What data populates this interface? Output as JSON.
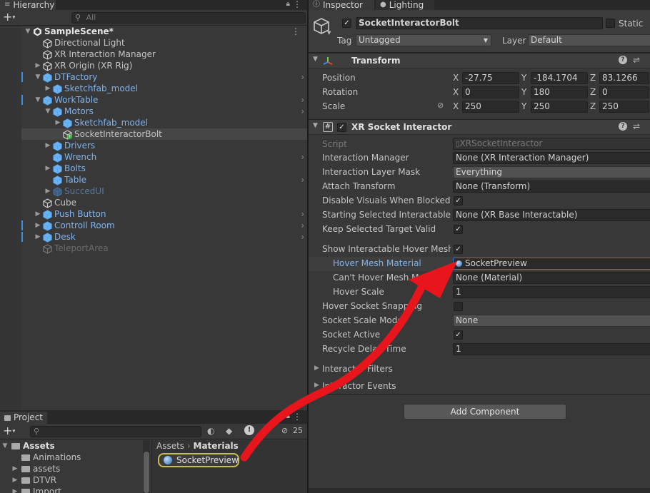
{
  "hierarchy": {
    "tab_label": "Hierarchy",
    "search_placeholder": "All",
    "rows": [
      {
        "label": "SampleScene*",
        "type": "scene",
        "indent": 0,
        "arrow": "▼",
        "color": "white"
      },
      {
        "label": "Directional Light",
        "type": "go",
        "indent": 1,
        "arrow": "",
        "color": "normal"
      },
      {
        "label": "XR Interaction Manager",
        "type": "go",
        "indent": 1,
        "arrow": "",
        "color": "normal"
      },
      {
        "label": "XR Origin (XR Rig)",
        "type": "go",
        "indent": 1,
        "arrow": "▶",
        "color": "normal"
      },
      {
        "label": "DTFactory",
        "type": "prefab",
        "indent": 1,
        "arrow": "▼",
        "color": "blue",
        "chevron": true,
        "bar": true
      },
      {
        "label": "Sketchfab_model",
        "type": "prefab",
        "indent": 2,
        "arrow": "▶",
        "color": "blue"
      },
      {
        "label": "WorkTable",
        "type": "prefab",
        "indent": 1,
        "arrow": "▼",
        "color": "blue",
        "chevron": true,
        "bar": true
      },
      {
        "label": "Motors",
        "type": "prefab",
        "indent": 2,
        "arrow": "▼",
        "color": "blue",
        "chevron": true
      },
      {
        "label": "Sketchfab_model",
        "type": "prefab",
        "indent": 3,
        "arrow": "▶",
        "color": "blue"
      },
      {
        "label": "SocketInteractorBolt",
        "type": "go-added",
        "indent": 3,
        "arrow": "",
        "color": "normal",
        "selected": true
      },
      {
        "label": "Drivers",
        "type": "prefab",
        "indent": 2,
        "arrow": "▶",
        "color": "blue"
      },
      {
        "label": "Wrench",
        "type": "prefab",
        "indent": 2,
        "arrow": "",
        "color": "blue",
        "chevron": true
      },
      {
        "label": "Bolts",
        "type": "prefab",
        "indent": 2,
        "arrow": "▶",
        "color": "blue"
      },
      {
        "label": "Table",
        "type": "prefab",
        "indent": 2,
        "arrow": "",
        "color": "blue",
        "chevron": true
      },
      {
        "label": "SuccedUI",
        "type": "prefab",
        "indent": 2,
        "arrow": "▶",
        "color": "dimblue"
      },
      {
        "label": "Cube",
        "type": "go",
        "indent": 1,
        "arrow": "",
        "color": "normal"
      },
      {
        "label": "Push Button",
        "type": "prefab",
        "indent": 1,
        "arrow": "▶",
        "color": "blue",
        "chevron": true
      },
      {
        "label": "Controll Room",
        "type": "prefab",
        "indent": 1,
        "arrow": "▶",
        "color": "blue",
        "chevron": true,
        "bar": true
      },
      {
        "label": "Desk",
        "type": "prefab",
        "indent": 1,
        "arrow": "▶",
        "color": "blue",
        "chevron": true,
        "bar": true
      },
      {
        "label": "TeleportArea",
        "type": "go",
        "indent": 1,
        "arrow": "",
        "color": "dim"
      }
    ]
  },
  "project": {
    "tab_label": "Project",
    "hidden_count": "25",
    "tree_root": "Assets",
    "tree_items": [
      "Animations",
      "assets",
      "DTVR",
      "Import"
    ],
    "breadcrumb": [
      "Assets",
      "Materials"
    ],
    "selected_asset": "SocketPreview"
  },
  "inspector": {
    "tabs": [
      "Inspector",
      "Lighting"
    ],
    "object_name": "SocketInteractorBolt",
    "static_label": "Static",
    "tag_label": "Tag",
    "tag_value": "Untagged",
    "layer_label": "Layer",
    "layer_value": "Default",
    "transform": {
      "title": "Transform",
      "rows": [
        {
          "label": "Position",
          "x": "-27.75",
          "y": "-184.1704",
          "z": "83.1266"
        },
        {
          "label": "Rotation",
          "x": "0",
          "y": "180",
          "z": "0"
        },
        {
          "label": "Scale",
          "x": "250",
          "y": "250",
          "z": "250"
        }
      ]
    },
    "socket": {
      "title": "XR Socket Interactor",
      "script_label": "Script",
      "script_value": "XRSocketInteractor",
      "props": [
        {
          "label": "Interaction Manager",
          "value": "None (XR Interaction Manager)",
          "kind": "object"
        },
        {
          "label": "Interaction Layer Mask",
          "value": "Everything",
          "kind": "dropdown"
        },
        {
          "label": "Attach Transform",
          "value": "None (Transform)",
          "kind": "object"
        },
        {
          "label": "Disable Visuals When Blocked In",
          "value": "",
          "kind": "check"
        },
        {
          "label": "Starting Selected Interactable",
          "value": "None (XR Base Interactable)",
          "kind": "object"
        },
        {
          "label": "Keep Selected Target Valid",
          "value": "",
          "kind": "check"
        },
        {
          "label": "Show Interactable Hover Meshe",
          "value": "",
          "kind": "check"
        },
        {
          "label": "Hover Mesh Material",
          "value": "SocketPreview",
          "kind": "material",
          "sub": true,
          "highlight": true
        },
        {
          "label": "Can't Hover Mesh Material",
          "value": "None (Material)",
          "kind": "object",
          "sub": true
        },
        {
          "label": "Hover Scale",
          "value": "1",
          "kind": "text",
          "sub": true
        },
        {
          "label": "Hover Socket Snapping",
          "value": "",
          "kind": "empty"
        },
        {
          "label": "Socket Scale Mode",
          "value": "None",
          "kind": "dropdown"
        },
        {
          "label": "Socket Active",
          "value": "",
          "kind": "check"
        },
        {
          "label": "Recycle Delay Time",
          "value": "1",
          "kind": "text"
        }
      ],
      "foldouts": [
        "Interactor Filters",
        "Interactor Events"
      ]
    },
    "add_component": "Add Component"
  },
  "colors": {
    "annotation_arrow": "#e8161c",
    "selection_outline": "#2d78c8",
    "prefab_blue": "#7fb3ef"
  }
}
